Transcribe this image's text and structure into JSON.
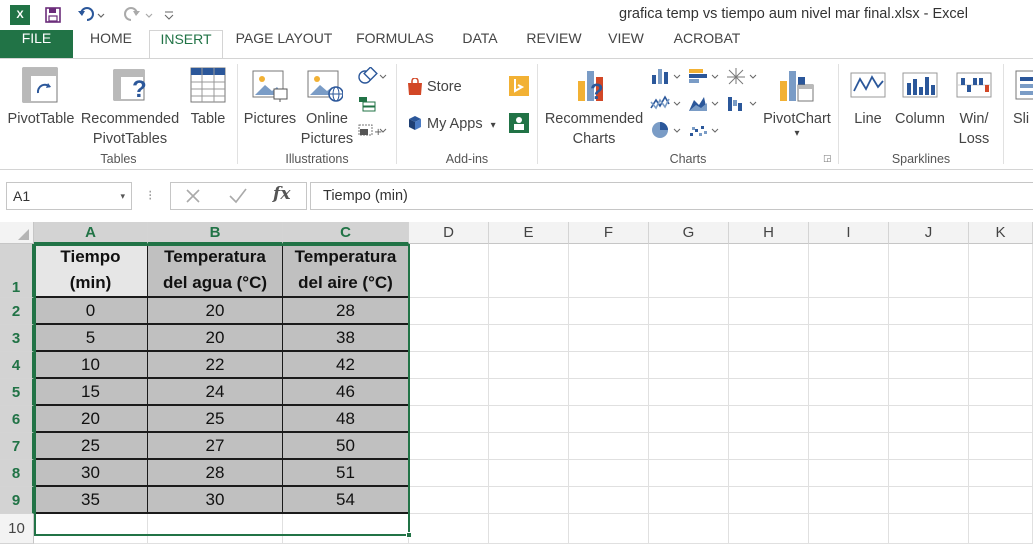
{
  "window": {
    "title": "grafica temp vs tiempo aum nivel mar final.xlsx - Excel",
    "logo": "X"
  },
  "tabs": [
    "FILE",
    "HOME",
    "INSERT",
    "PAGE LAYOUT",
    "FORMULAS",
    "DATA",
    "REVIEW",
    "VIEW",
    "ACROBAT"
  ],
  "ribbon": {
    "pivottable": "PivotTable",
    "recommended1": "Recommended",
    "recommended2": "PivotTables",
    "table": "Table",
    "pictures": "Pictures",
    "online1": "Online",
    "online2": "Pictures",
    "store": "Store",
    "myapps": "My Apps",
    "reccharts1": "Recommended",
    "reccharts2": "Charts",
    "pivotchart": "PivotChart",
    "line": "Line",
    "column": "Column",
    "winloss1": "Win/",
    "winloss2": "Loss",
    "slicer": "Sli",
    "groups": {
      "tables": "Tables",
      "illustrations": "Illustrations",
      "addins": "Add-ins",
      "charts": "Charts",
      "sparklines": "Sparklines"
    }
  },
  "formula_bar": {
    "name_box": "A1",
    "fx": "fx",
    "formula": "Tiempo (min)"
  },
  "columns": [
    "A",
    "B",
    "C",
    "D",
    "E",
    "F",
    "G",
    "H",
    "I",
    "J",
    "K"
  ],
  "rows": [
    "1",
    "2",
    "3",
    "4",
    "5",
    "6",
    "7",
    "8",
    "9",
    "10"
  ],
  "sheet": {
    "header": [
      [
        "Tiempo",
        "(min)"
      ],
      [
        "Temperatura",
        "del agua (°C)"
      ],
      [
        "Temperatura",
        "del aire (°C)"
      ]
    ],
    "data": [
      [
        "0",
        "20",
        "28"
      ],
      [
        "5",
        "20",
        "38"
      ],
      [
        "10",
        "22",
        "42"
      ],
      [
        "15",
        "24",
        "46"
      ],
      [
        "20",
        "25",
        "48"
      ],
      [
        "25",
        "27",
        "50"
      ],
      [
        "30",
        "28",
        "51"
      ],
      [
        "35",
        "30",
        "54"
      ]
    ]
  },
  "colors": {
    "accent": "#217346",
    "cell_fill": "#c0c0c0"
  }
}
